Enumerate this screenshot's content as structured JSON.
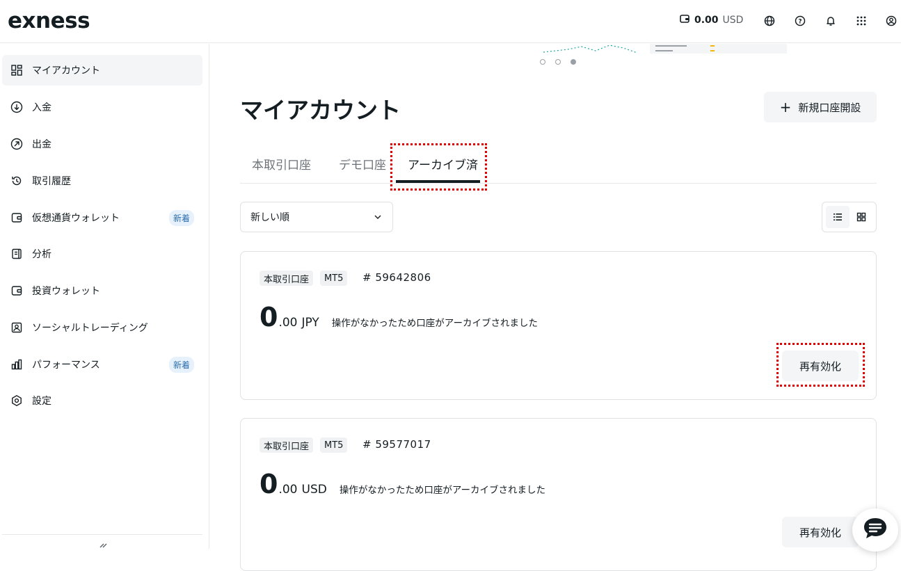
{
  "header": {
    "logo": "exness",
    "balance_amount": "0.00",
    "balance_currency": "USD",
    "icons": [
      "wallet-icon",
      "globe-icon",
      "help-icon",
      "bell-icon",
      "apps-grid-icon",
      "profile-icon"
    ]
  },
  "sidebar": {
    "items": [
      {
        "label": "マイアカウント",
        "icon": "dashboard-icon",
        "active": true
      },
      {
        "label": "入金",
        "icon": "deposit-icon"
      },
      {
        "label": "出金",
        "icon": "withdraw-icon"
      },
      {
        "label": "取引履歴",
        "icon": "history-icon"
      },
      {
        "label": "仮想通貨ウォレット",
        "icon": "wallet-icon",
        "badge": "新着"
      },
      {
        "label": "分析",
        "icon": "analytics-icon"
      },
      {
        "label": "投資ウォレット",
        "icon": "wallet-icon"
      },
      {
        "label": "ソーシャルトレーディング",
        "icon": "social-trading-icon"
      },
      {
        "label": "パフォーマンス",
        "icon": "bar-chart-icon",
        "badge": "新着"
      },
      {
        "label": "設定",
        "icon": "settings-icon"
      }
    ]
  },
  "main": {
    "title": "マイアカウント",
    "new_account_label": "新規口座開設",
    "tabs": [
      {
        "label": "本取引口座"
      },
      {
        "label": "デモ口座"
      },
      {
        "label": "アーカイブ済",
        "active": true
      }
    ],
    "sort": {
      "selected": "新しい順"
    },
    "carousel": {
      "slides": 3,
      "active_index": 2
    },
    "accounts": [
      {
        "type": "本取引口座",
        "platform": "MT5",
        "number": "# 59642806",
        "balance_int": "0",
        "balance_dec": ".00",
        "currency": "JPY",
        "note": "操作がなかったため口座がアーカイブされました",
        "action": "再有効化"
      },
      {
        "type": "本取引口座",
        "platform": "MT5",
        "number": "# 59577017",
        "balance_int": "0",
        "balance_dec": ".00",
        "currency": "USD",
        "note": "操作がなかったため口座がアーカイブされました",
        "action": "再有効化"
      }
    ]
  },
  "colors": {
    "highlight": "#e00000",
    "text": "#141d22",
    "badge_bg": "#e6f1fb",
    "badge_text": "#2f6fad"
  }
}
